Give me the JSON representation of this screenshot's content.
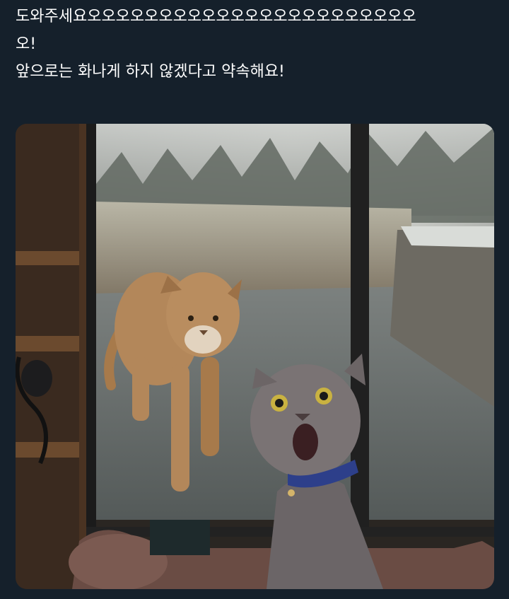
{
  "tweet": {
    "text_lines": [
      "도와주세요오오오오오오오오오오오오오오오오오오오오오오오",
      "오!",
      "앞으로는 화나게 하지 않겠다고 약속해요!"
    ]
  },
  "media": {
    "kind": "photo"
  },
  "colors": {
    "background": "#15202b",
    "text": "#ffffff"
  }
}
